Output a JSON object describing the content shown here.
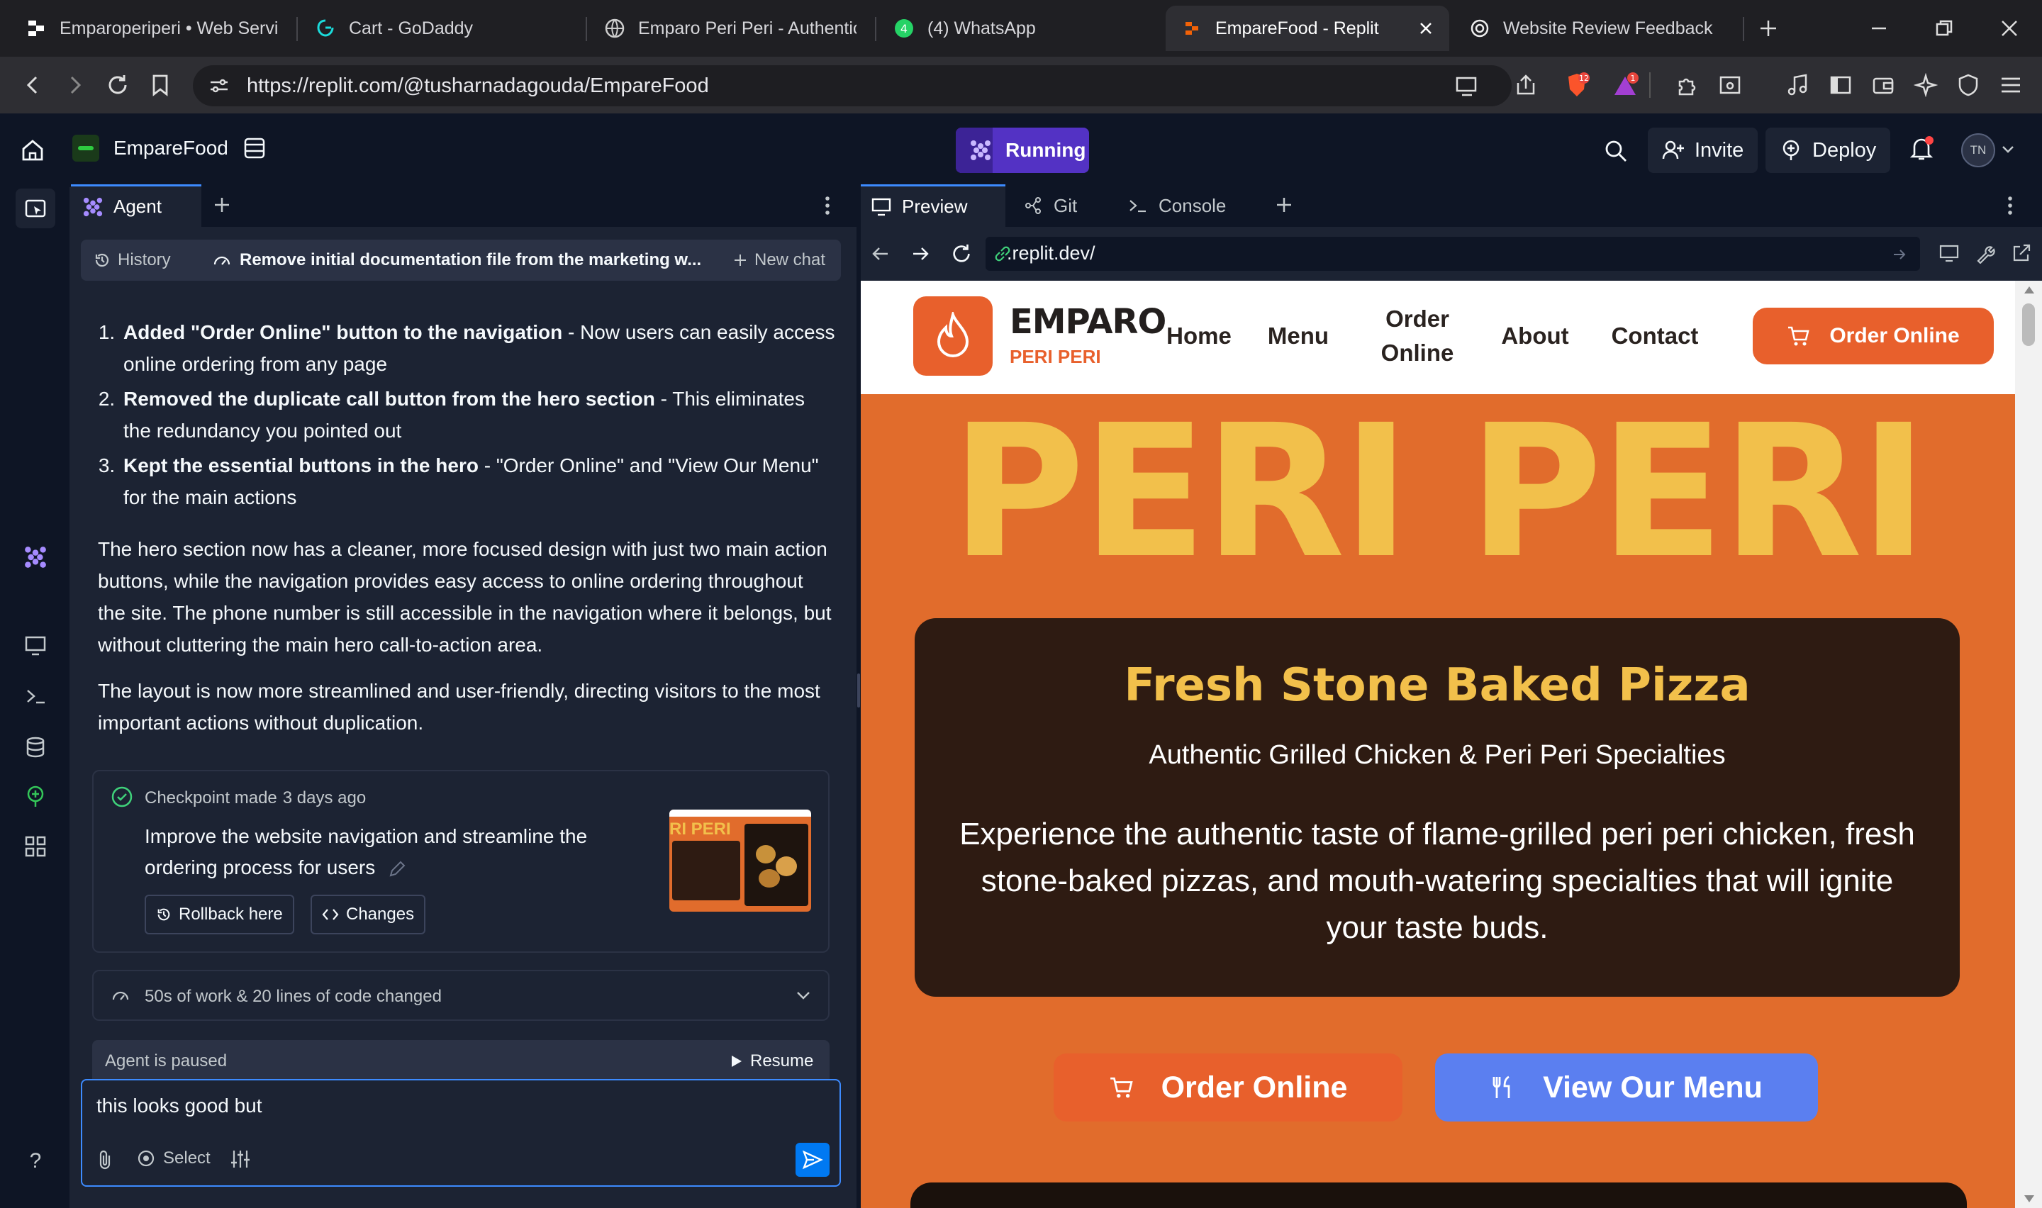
{
  "browser": {
    "tabs": [
      {
        "title": "Emparoperiperi • Web Servic",
        "icon": "replit-logo-icon"
      },
      {
        "title": "Cart - GoDaddy",
        "icon": "godaddy-icon"
      },
      {
        "title": "Emparo Peri Peri - Authentic",
        "icon": "globe-icon"
      },
      {
        "title": "(4) WhatsApp",
        "icon": "whatsapp-icon",
        "badge": "4"
      },
      {
        "title": "EmpareFood - Replit",
        "icon": "replit-icon",
        "active": true
      },
      {
        "title": "Website Review Feedback",
        "icon": "chatgpt-icon"
      }
    ],
    "url": "https://replit.com/@tusharnadagouda/EmpareFood",
    "brave_shield_count": "12",
    "rewards_count": "1"
  },
  "replit": {
    "project_name": "EmpareFood",
    "run_status": "Running",
    "invite_label": "Invite",
    "deploy_label": "Deploy",
    "avatar_initials": "TN",
    "help_label": "?"
  },
  "agent": {
    "tab_label": "Agent",
    "history_label": "History",
    "current_chat_title": "Remove initial documentation file from the marketing w...",
    "new_chat_label": "New chat",
    "list_items": [
      {
        "bold": "Added \"Order Online\" button to the navigation",
        "text": " - Now users can easily access online ordering from any page"
      },
      {
        "bold": "Removed the duplicate call button from the hero section",
        "text": " - This eliminates the redundancy you pointed out"
      },
      {
        "bold": "Kept the essential buttons in the hero",
        "text": " - \"Order Online\" and \"View Our Menu\" for the main actions"
      }
    ],
    "paragraphs": [
      "The hero section now has a cleaner, more focused design with just two main action buttons, while the navigation provides easy access to online ordering throughout the site. The phone number is still accessible in the navigation where it belongs, but without cluttering the main hero call-to-action area.",
      "The layout is now more streamlined and user-friendly, directing visitors to the most important actions without duplication."
    ],
    "checkpoint": {
      "label": "Checkpoint made",
      "time": "3 days ago",
      "description": "Improve the website navigation and streamline the ordering process for users",
      "rollback_label": "Rollback here",
      "changes_label": "Changes",
      "thumbnail_text": "RI PERI"
    },
    "work_summary": "50s of work & 20 lines of code changed",
    "paused_label": "Agent is paused",
    "resume_label": "Resume",
    "input_value": "this looks good but",
    "select_label": "Select"
  },
  "preview": {
    "tabs": [
      "Preview",
      "Git",
      "Console"
    ],
    "url": ".replit.dev/"
  },
  "website": {
    "brand_name": "EMPARO",
    "brand_sub": "PERI PERI",
    "nav": [
      "Home",
      "Menu",
      "Order\nOnline",
      "About",
      "Contact"
    ],
    "nav_cta": "Order Online",
    "hero_title": "PERI PERI",
    "card_title": "Fresh Stone Baked Pizza",
    "card_subtitle": "Authentic Grilled Chicken & Peri Peri Specialties",
    "card_text": "Experience the authentic taste of flame-grilled peri peri chicken, fresh stone-baked pizzas, and mouth-watering specialties that will ignite your taste buds.",
    "cta_order": "Order Online",
    "cta_menu": "View Our Menu",
    "colors": {
      "orange": "#e16c2c",
      "yellow": "#f2c04b",
      "dark": "#2e1b12",
      "blue": "#5b7ff0"
    }
  },
  "colors": {
    "replit_bg": "#0e1525",
    "replit_panel": "#1c2333",
    "running": "#5332c4",
    "accent": "#3d8bff"
  }
}
